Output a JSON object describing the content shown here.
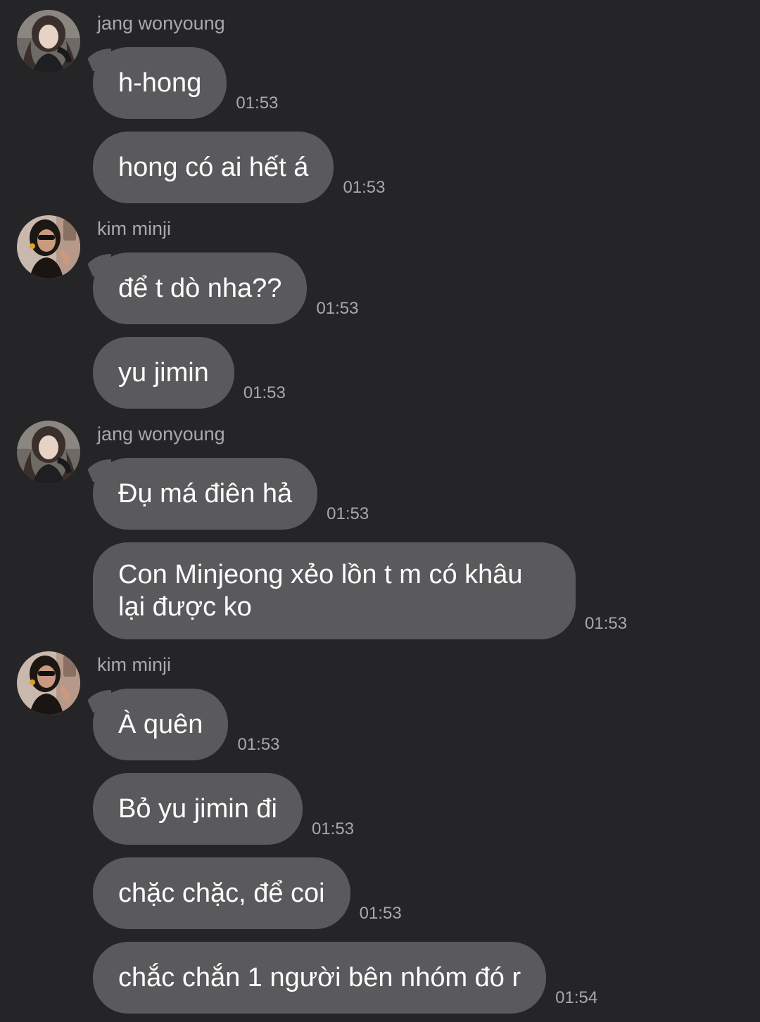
{
  "messages": {
    "g1": {
      "sender": "jang wonyoung",
      "avatar": "avatar-wonyoung",
      "m1": {
        "text": "h-hong",
        "time": "01:53"
      },
      "m2": {
        "text": "hong có ai hết á",
        "time": "01:53"
      }
    },
    "g2": {
      "sender": "kim minji",
      "avatar": "avatar-minji",
      "m1": {
        "text": "để t dò nha??",
        "time": "01:53"
      },
      "m2": {
        "text": "yu jimin",
        "time": "01:53"
      }
    },
    "g3": {
      "sender": "jang wonyoung",
      "avatar": "avatar-wonyoung",
      "m1": {
        "text": "Đụ má điên hả",
        "time": "01:53"
      },
      "m2": {
        "text": "Con Minjeong xẻo lồn t m có khâu lại được ko",
        "time": "01:53"
      }
    },
    "g4": {
      "sender": "kim minji",
      "avatar": "avatar-minji",
      "m1": {
        "text": "À quên",
        "time": "01:53"
      },
      "m2": {
        "text": "Bỏ yu jimin đi",
        "time": "01:53"
      },
      "m3": {
        "text": "chặc chặc, để coi",
        "time": "01:53"
      },
      "m4": {
        "text": "chắc chắn 1 người bên nhóm đó r",
        "time": "01:54"
      }
    }
  },
  "colors": {
    "background": "#252527",
    "bubble": "#5a5a5c",
    "meta_text": "#a8a8ad",
    "message_text": "#ffffff"
  }
}
